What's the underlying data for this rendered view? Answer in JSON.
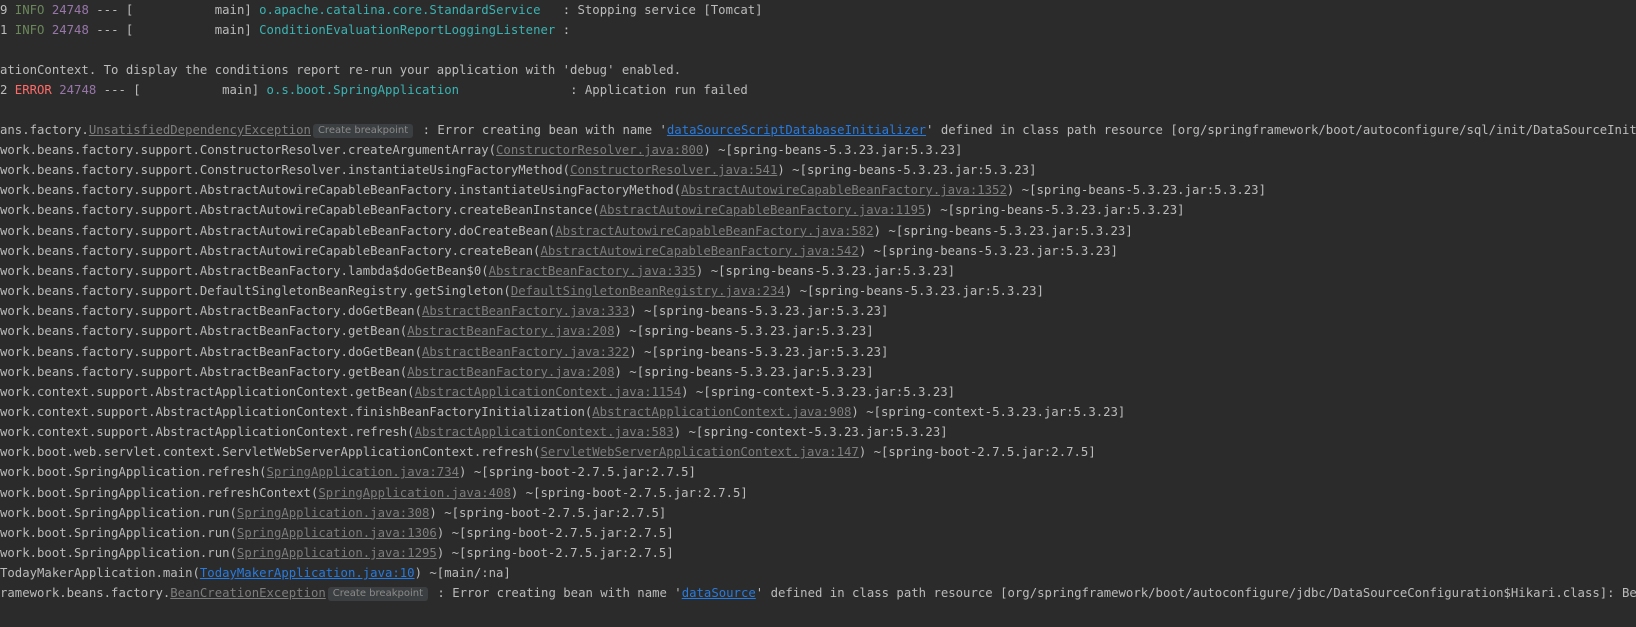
{
  "colors": {
    "background": "#2b2b2b",
    "text": "#bbbbbb",
    "info": "#6a8759",
    "error": "#ff6b68",
    "pid": "#9876aa",
    "logger": "#3bb3b3",
    "link": "#287bde",
    "source_link": "#7d7d7d"
  },
  "log": {
    "l1": {
      "prefix": "9",
      "level": " INFO",
      "pid": "24748",
      "sep": " --- [           main] ",
      "logger": "o.apache.catalina.core.StandardService",
      "rest": "   : Stopping service [Tomcat]"
    },
    "l2": {
      "prefix": "1",
      "level": " INFO",
      "pid": "24748",
      "sep": " --- [           main] ",
      "logger": "ConditionEvaluationReportLoggingListener",
      "rest": " :"
    },
    "l3": {
      "text": "ationContext. To display the conditions report re-run your application with 'debug' enabled."
    },
    "l4": {
      "prefix": "2",
      "level": " ERROR",
      "pid": "24748",
      "sep": " --- [           main] ",
      "logger": "o.s.boot.SpringApplication",
      "rest": "               : Application run failed"
    },
    "l5": {
      "pre": "ans.factory.",
      "exc": "UnsatisfiedDependencyException",
      "bp": "Create breakpoint",
      "mid": " : Error creating bean with name '",
      "bean": "dataSourceScriptDatabaseInitializer",
      "post": "' defined in class path resource [org/springframework/boot/autoconfigure/sql/init/DataSourceInitializationCon"
    },
    "frames": [
      {
        "pre": "work.beans.factory.support.ConstructorResolver.createArgumentArray(",
        "src": "ConstructorResolver.java:800",
        "post": ") ~[spring-beans-5.3.23.jar:5.3.23]"
      },
      {
        "pre": "work.beans.factory.support.ConstructorResolver.instantiateUsingFactoryMethod(",
        "src": "ConstructorResolver.java:541",
        "post": ") ~[spring-beans-5.3.23.jar:5.3.23]"
      },
      {
        "pre": "work.beans.factory.support.AbstractAutowireCapableBeanFactory.instantiateUsingFactoryMethod(",
        "src": "AbstractAutowireCapableBeanFactory.java:1352",
        "post": ") ~[spring-beans-5.3.23.jar:5.3.23]"
      },
      {
        "pre": "work.beans.factory.support.AbstractAutowireCapableBeanFactory.createBeanInstance(",
        "src": "AbstractAutowireCapableBeanFactory.java:1195",
        "post": ") ~[spring-beans-5.3.23.jar:5.3.23]"
      },
      {
        "pre": "work.beans.factory.support.AbstractAutowireCapableBeanFactory.doCreateBean(",
        "src": "AbstractAutowireCapableBeanFactory.java:582",
        "post": ") ~[spring-beans-5.3.23.jar:5.3.23]"
      },
      {
        "pre": "work.beans.factory.support.AbstractAutowireCapableBeanFactory.createBean(",
        "src": "AbstractAutowireCapableBeanFactory.java:542",
        "post": ") ~[spring-beans-5.3.23.jar:5.3.23]"
      },
      {
        "pre": "work.beans.factory.support.AbstractBeanFactory.lambda$doGetBean$0(",
        "src": "AbstractBeanFactory.java:335",
        "post": ") ~[spring-beans-5.3.23.jar:5.3.23]"
      },
      {
        "pre": "work.beans.factory.support.DefaultSingletonBeanRegistry.getSingleton(",
        "src": "DefaultSingletonBeanRegistry.java:234",
        "post": ") ~[spring-beans-5.3.23.jar:5.3.23]"
      },
      {
        "pre": "work.beans.factory.support.AbstractBeanFactory.doGetBean(",
        "src": "AbstractBeanFactory.java:333",
        "post": ") ~[spring-beans-5.3.23.jar:5.3.23]"
      },
      {
        "pre": "work.beans.factory.support.AbstractBeanFactory.getBean(",
        "src": "AbstractBeanFactory.java:208",
        "post": ") ~[spring-beans-5.3.23.jar:5.3.23]"
      },
      {
        "pre": "work.beans.factory.support.AbstractBeanFactory.doGetBean(",
        "src": "AbstractBeanFactory.java:322",
        "post": ") ~[spring-beans-5.3.23.jar:5.3.23]"
      },
      {
        "pre": "work.beans.factory.support.AbstractBeanFactory.getBean(",
        "src": "AbstractBeanFactory.java:208",
        "post": ") ~[spring-beans-5.3.23.jar:5.3.23]"
      },
      {
        "pre": "work.context.support.AbstractApplicationContext.getBean(",
        "src": "AbstractApplicationContext.java:1154",
        "post": ") ~[spring-context-5.3.23.jar:5.3.23]"
      },
      {
        "pre": "work.context.support.AbstractApplicationContext.finishBeanFactoryInitialization(",
        "src": "AbstractApplicationContext.java:908",
        "post": ") ~[spring-context-5.3.23.jar:5.3.23]"
      },
      {
        "pre": "work.context.support.AbstractApplicationContext.refresh(",
        "src": "AbstractApplicationContext.java:583",
        "post": ") ~[spring-context-5.3.23.jar:5.3.23]"
      },
      {
        "pre": "work.boot.web.servlet.context.ServletWebServerApplicationContext.refresh(",
        "src": "ServletWebServerApplicationContext.java:147",
        "post": ") ~[spring-boot-2.7.5.jar:2.7.5]"
      },
      {
        "pre": "work.boot.SpringApplication.refresh(",
        "src": "SpringApplication.java:734",
        "post": ") ~[spring-boot-2.7.5.jar:2.7.5]"
      },
      {
        "pre": "work.boot.SpringApplication.refreshContext(",
        "src": "SpringApplication.java:408",
        "post": ") ~[spring-boot-2.7.5.jar:2.7.5]"
      },
      {
        "pre": "work.boot.SpringApplication.run(",
        "src": "SpringApplication.java:308",
        "post": ") ~[spring-boot-2.7.5.jar:2.7.5]"
      },
      {
        "pre": "work.boot.SpringApplication.run(",
        "src": "SpringApplication.java:1306",
        "post": ") ~[spring-boot-2.7.5.jar:2.7.5]"
      },
      {
        "pre": "work.boot.SpringApplication.run(",
        "src": "SpringApplication.java:1295",
        "post": ") ~[spring-boot-2.7.5.jar:2.7.5]"
      }
    ],
    "l27": {
      "pre": "TodayMakerApplication.main(",
      "src": "TodayMakerApplication.java:10",
      "post": ") ~[main/:na]"
    },
    "l28": {
      "pre": "ramework.beans.factory.",
      "exc": "BeanCreationException",
      "bp": "Create breakpoint",
      "mid": " : Error creating bean with name '",
      "bean": "dataSource",
      "post": "' defined in class path resource [org/springframework/boot/autoconfigure/jdbc/DataSourceConfiguration$Hikari.class]: Bean instantiat"
    }
  }
}
